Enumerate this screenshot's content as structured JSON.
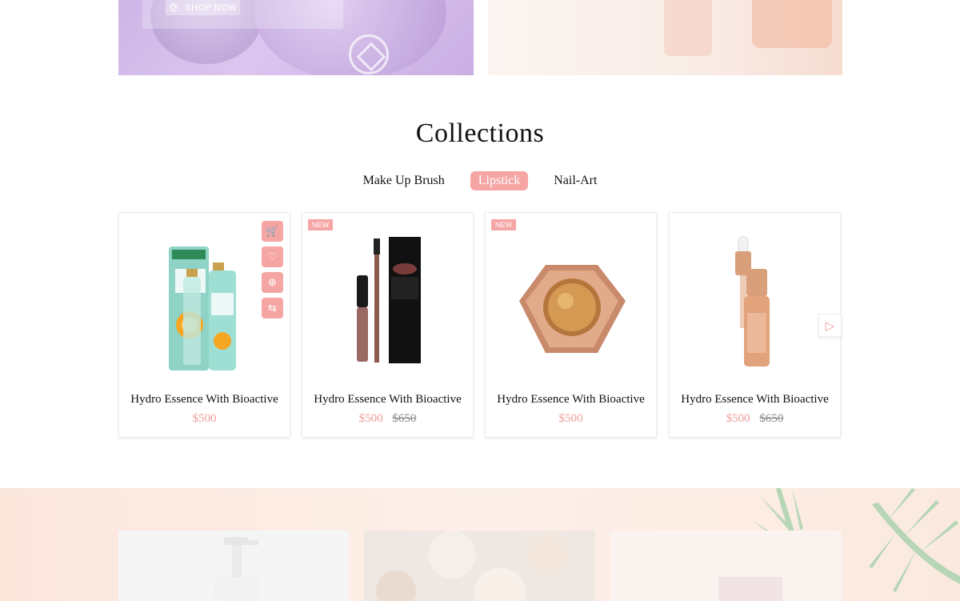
{
  "banner_left": {
    "button_label": "SHOP NOW"
  },
  "collections": {
    "title": "Collections",
    "tabs": [
      {
        "label": "Make Up Brush",
        "active": false
      },
      {
        "label": "Lipstick",
        "active": true
      },
      {
        "label": "Nail-Art",
        "active": false
      }
    ]
  },
  "products": [
    {
      "name": "Hydro Essence With Bioactive",
      "price": "$500",
      "old_price": "",
      "badge": "",
      "image": "fresh-juice-bottles"
    },
    {
      "name": "Hydro Essence With Bioactive",
      "price": "$500",
      "old_price": "$650",
      "badge": "NEW",
      "image": "lip-kit"
    },
    {
      "name": "Hydro Essence With Bioactive",
      "price": "$500",
      "old_price": "",
      "badge": "NEW",
      "image": "highlighter-compact"
    },
    {
      "name": "Hydro Essence With Bioactive",
      "price": "$500",
      "old_price": "$650",
      "badge": "",
      "image": "dropper-serum"
    }
  ],
  "product_actions": [
    "cart-icon",
    "heart-icon",
    "zoom-icon",
    "compare-icon"
  ],
  "colors": {
    "accent": "#f6a5a5",
    "price": "#f29c9c"
  }
}
